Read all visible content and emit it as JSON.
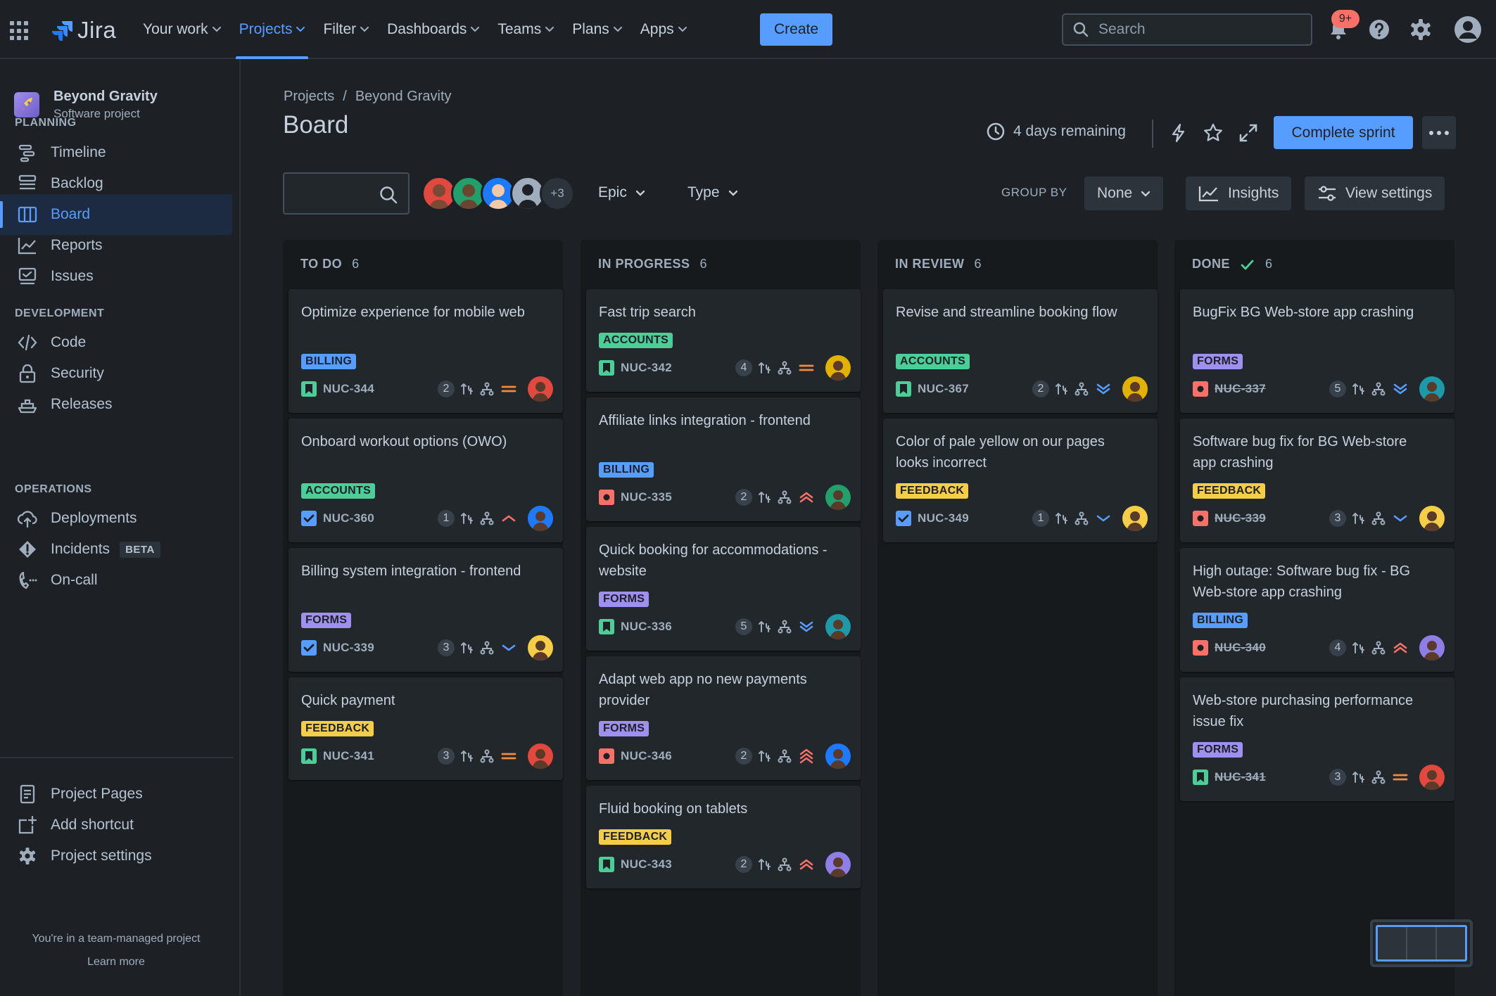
{
  "topnav": {
    "logo": "Jira",
    "items": [
      "Your work",
      "Projects",
      "Filter",
      "Dashboards",
      "Teams",
      "Plans",
      "Apps"
    ],
    "active": "Projects",
    "create": "Create",
    "search_placeholder": "Search",
    "notif_badge": "9+",
    "accent": "#579dff"
  },
  "sidebar": {
    "project_name": "Beyond Gravity",
    "project_type": "Software project",
    "planning_header": "PLANNING",
    "planning": [
      "Timeline",
      "Backlog",
      "Board",
      "Reports",
      "Issues"
    ],
    "development_header": "DEVELOPMENT",
    "development": [
      "Code",
      "Security",
      "Releases"
    ],
    "operations_header": "OPERATIONS",
    "operations": [
      "Deployments",
      "Incidents",
      "On-call"
    ],
    "beta": "BETA",
    "bottom": [
      "Project Pages",
      "Add shortcut",
      "Project settings"
    ],
    "footer_text": "You're in a team-managed project",
    "footer_link": "Learn more"
  },
  "header": {
    "breadcrumb_root": "Projects",
    "breadcrumb_sep": "/",
    "breadcrumb_project": "Beyond Gravity",
    "title": "Board",
    "days_remaining": "4 days remaining",
    "complete_sprint": "Complete sprint"
  },
  "filters": {
    "avatars_more": "+3",
    "epic": "Epic",
    "type": "Type",
    "group_by": "GROUP BY",
    "group_value": "None",
    "insights": "Insights",
    "view_settings": "View settings"
  },
  "columns": [
    {
      "name": "TO DO",
      "count": "6",
      "done": false,
      "cards": [
        {
          "title": "Optimize experience for mobile web",
          "label": "BILLING",
          "label_type": "billing",
          "type": "story",
          "key": "NUC-344",
          "est": "2",
          "priority": "medium",
          "avatar": "#e2483d"
        },
        {
          "title": "Onboard workout options (OWO)",
          "label": "ACCOUNTS",
          "label_type": "accounts",
          "type": "task",
          "key": "NUC-360",
          "est": "1",
          "priority": "high",
          "avatar": "#1d7afc"
        },
        {
          "title": "Billing system integration - frontend",
          "label": "FORMS",
          "label_type": "forms",
          "type": "task",
          "key": "NUC-339",
          "est": "3",
          "priority": "low",
          "avatar": "#f5cd47"
        },
        {
          "title": "Quick payment",
          "label": "FEEDBACK",
          "label_type": "feedback",
          "type": "story",
          "key": "NUC-341",
          "est": "3",
          "priority": "medium",
          "avatar": "#e2483d"
        }
      ]
    },
    {
      "name": "IN PROGRESS",
      "count": "6",
      "done": false,
      "cards": [
        {
          "title": "Fast trip search",
          "label": "ACCOUNTS",
          "label_type": "accounts",
          "type": "story",
          "key": "NUC-342",
          "est": "4",
          "priority": "medium",
          "avatar": "#e2b203"
        },
        {
          "title": "Affiliate links integration - frontend",
          "label": "BILLING",
          "label_type": "billing",
          "type": "bug",
          "key": "NUC-335",
          "est": "2",
          "priority": "highest",
          "avatar": "#22a06b"
        },
        {
          "title": "Quick booking for accommodations - website",
          "label": "FORMS",
          "label_type": "forms",
          "type": "story",
          "key": "NUC-336",
          "est": "5",
          "priority": "lowest",
          "avatar": "#1d9aaa"
        },
        {
          "title": "Adapt web app no new payments provider",
          "label": "FORMS",
          "label_type": "forms",
          "type": "bug",
          "key": "NUC-346",
          "est": "2",
          "priority": "critical",
          "avatar": "#1d7afc"
        },
        {
          "title": "Fluid booking on tablets",
          "label": "FEEDBACK",
          "label_type": "feedback",
          "type": "story",
          "key": "NUC-343",
          "est": "2",
          "priority": "highest",
          "avatar": "#8f7ee7"
        }
      ]
    },
    {
      "name": "IN REVIEW",
      "count": "6",
      "done": false,
      "cards": [
        {
          "title": "Revise and streamline booking flow",
          "label": "ACCOUNTS",
          "label_type": "accounts",
          "type": "story",
          "key": "NUC-367",
          "est": "2",
          "priority": "lowest",
          "avatar": "#e2b203"
        },
        {
          "title": "Color of pale yellow on our pages looks incorrect",
          "label": "FEEDBACK",
          "label_type": "feedback",
          "type": "task",
          "key": "NUC-349",
          "est": "1",
          "priority": "low",
          "avatar": "#f5cd47"
        }
      ]
    },
    {
      "name": "DONE",
      "count": "6",
      "done": true,
      "cards": [
        {
          "title": "BugFix BG Web-store app crashing",
          "label": "FORMS",
          "label_type": "forms",
          "type": "bug",
          "key": "NUC-337",
          "est": "5",
          "priority": "lowest",
          "avatar": "#1d9aaa"
        },
        {
          "title": "Software bug fix for BG Web-store app crashing",
          "label": "FEEDBACK",
          "label_type": "feedback",
          "type": "bug",
          "key": "NUC-339",
          "est": "3",
          "priority": "low",
          "avatar": "#f5cd47"
        },
        {
          "title": "High outage: Software bug fix - BG Web-store app crashing",
          "label": "BILLING",
          "label_type": "billing",
          "type": "bug",
          "key": "NUC-340",
          "est": "4",
          "priority": "highest",
          "avatar": "#8f7ee7"
        },
        {
          "title": "Web-store purchasing performance issue fix",
          "label": "FORMS",
          "label_type": "forms",
          "type": "story",
          "key": "NUC-341",
          "est": "3",
          "priority": "medium",
          "avatar": "#e2483d"
        }
      ]
    }
  ]
}
